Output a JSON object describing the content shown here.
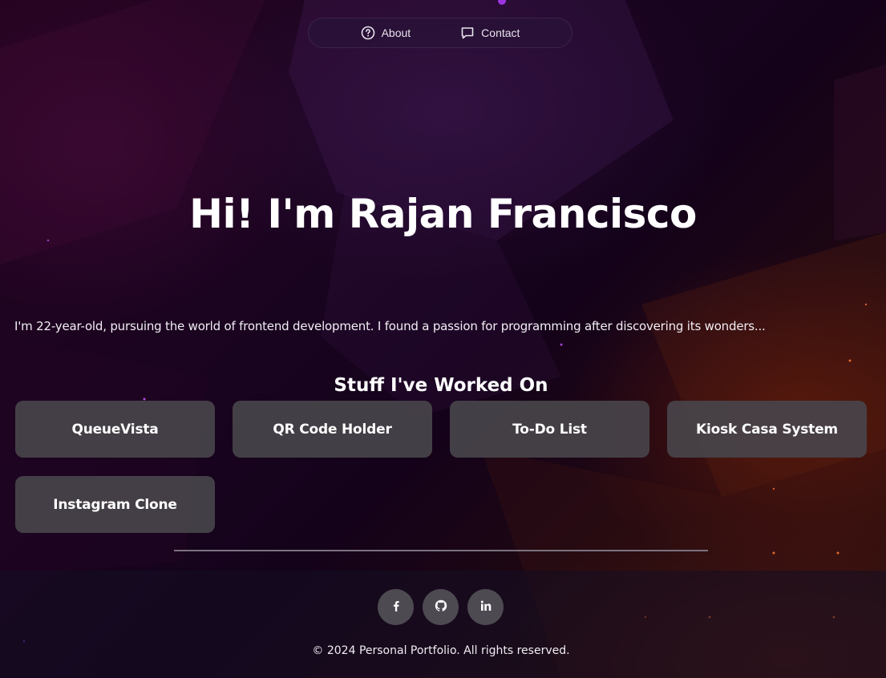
{
  "nav": {
    "items": [
      {
        "label": "About",
        "icon": "question-circle-icon"
      },
      {
        "label": "Contact",
        "icon": "message-icon"
      }
    ]
  },
  "hero": {
    "title": "Hi! I'm Rajan Francisco",
    "intro": "I'm 22-year-old, pursuing the world of frontend development. I found a passion for programming after discovering its wonders..."
  },
  "projects": {
    "heading": "Stuff I've Worked On",
    "items": [
      {
        "label": "QueueVista"
      },
      {
        "label": "QR Code Holder"
      },
      {
        "label": "To-Do List"
      },
      {
        "label": "Kiosk Casa System"
      },
      {
        "label": "Instagram Clone"
      }
    ]
  },
  "footer": {
    "social": [
      {
        "icon": "facebook-icon"
      },
      {
        "icon": "github-icon"
      },
      {
        "icon": "linkedin-icon"
      }
    ],
    "copyright": "© 2024 Personal Portfolio. All rights reserved."
  },
  "colors": {
    "background": "#1a0420",
    "card": "#48444a",
    "social_button": "#4d4a52",
    "text": "#ffffff"
  }
}
